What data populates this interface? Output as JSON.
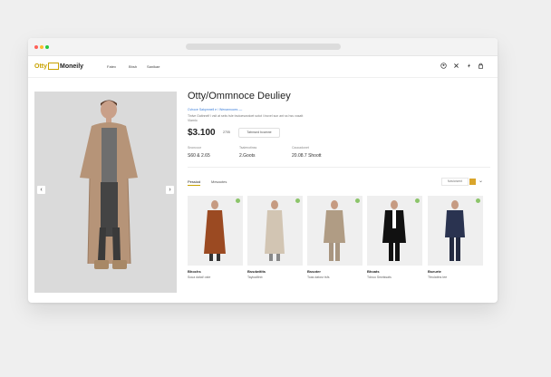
{
  "window": {
    "browser_dots": [
      "#ff5f57",
      "#febc2e",
      "#28c840"
    ]
  },
  "header": {
    "logo_left": "Otty",
    "logo_right": "Moneily",
    "nav": [
      "Fatex",
      "Bhsh",
      "Sanikae"
    ],
    "icons": [
      "user-icon",
      "close-icon",
      "lightning-icon",
      "bag-icon"
    ]
  },
  "gallery": {
    "prev_arrow": "‹",
    "next_arrow": "›"
  },
  "product": {
    "title": "Otty/Ommnoce Deuliey",
    "sublink": "Cvhoce Sakpmnell e / Wenannoces ––",
    "description_line1": "Tinlve Gaitnnelf i vsit at sekv tsle tnutoeswotoet sotot i lncvel sun ant ss hss vosatt",
    "description_line2": "Viamlo",
    "price": "$3.100",
    "option1": "2705",
    "option2": "Tatnnwol bcamne",
    "specs": [
      {
        "label": "Snoncoor",
        "value": "S60 & 2.65"
      },
      {
        "label": "Tsalenotinss",
        "value": "2.Goots"
      },
      {
        "label": "Caocadonet",
        "value": "20.08.7 Shoott"
      }
    ]
  },
  "tabs": {
    "items": [
      "Pessiod",
      "Mesaotes"
    ],
    "sort_label": "Navicisent",
    "sort_chevron": "⌄"
  },
  "products": [
    {
      "name": "Bhochs",
      "price": "Soua dalat/ oste",
      "color": "#9b4a22"
    },
    {
      "name": "Bssdwitlts",
      "price": "Tayloalltnb",
      "color": "#d2c5b3"
    },
    {
      "name": "Bssoter",
      "price": "Toas datosr tsfs",
      "color": "#b09c84"
    },
    {
      "name": "Bhoats",
      "price": "Tdnuo Sewtssats",
      "color": "#111111"
    },
    {
      "name": "Bseurte",
      "price": "Tfeolattns tee",
      "color": "#2a3350"
    }
  ],
  "colors": {
    "accent": "#c8a200",
    "badge": "#8cc46a",
    "link": "#3b7dd8"
  }
}
